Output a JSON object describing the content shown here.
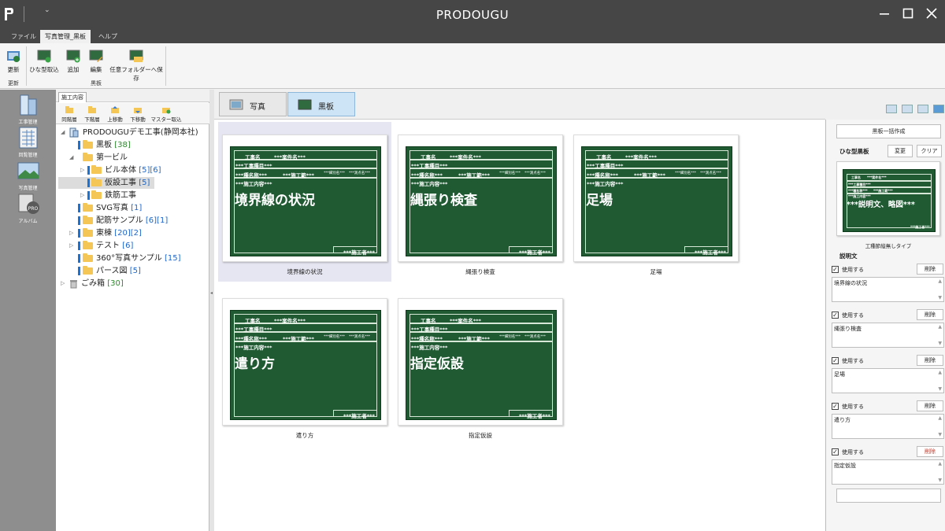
{
  "app": {
    "title": "PRODOUGU",
    "quick_access": "⌄"
  },
  "menu": {
    "tabs": [
      "ファイル",
      "写真管理_黒板",
      "ヘルプ"
    ],
    "active": 1
  },
  "ribbon": {
    "refresh_label": "更新",
    "refresh_group": "更新",
    "buttons": [
      "ひな型取込",
      "追加",
      "編集",
      "任意フォルダーへ保存"
    ],
    "board_group": "黒板"
  },
  "leftbar": [
    "工事管理",
    "回覧管理",
    "写真管理",
    "アルバム"
  ],
  "tree": {
    "tab": "施工内容",
    "tools": [
      "同階層",
      "下階層",
      "上移動",
      "下移動",
      "マスター取込"
    ],
    "nodes": [
      {
        "label": "PRODOUGUデモ工事(静岡本社)"
      },
      {
        "label": "黒板",
        "count": "[38]"
      },
      {
        "label": "第一ビル"
      },
      {
        "label": "ビル本体",
        "count": "[5][6]"
      },
      {
        "label": "仮設工事",
        "count": "[5]"
      },
      {
        "label": "鉄筋工事"
      },
      {
        "label": "SVG写真",
        "count": "[1]"
      },
      {
        "label": "配筋サンプル",
        "count": "[6][1]"
      },
      {
        "label": "東棟",
        "count": "[20][2]"
      },
      {
        "label": "テスト",
        "count": "[6]"
      },
      {
        "label": "360°写真サンプル",
        "count": "[15]"
      },
      {
        "label": "パース図",
        "count": "[5]"
      },
      {
        "label": "ごみ箱",
        "count": "[30]"
      }
    ]
  },
  "content_tabs": [
    "写真",
    "黒板"
  ],
  "board_template": {
    "kouji_mei": "工事名",
    "anken": "***案件名***",
    "kouji_shumoku": "***工事種目***",
    "shubetsu": "***種名称***",
    "kouji_ku": "***施工範***",
    "small1": "***細別名***",
    "small2": "***測点名***",
    "sekou_naiyou": "***施工内容***",
    "sekousha": "***施工者***"
  },
  "boards": [
    {
      "title": "境界線の状況",
      "caption": "境界線の状況"
    },
    {
      "title": "縄張り検査",
      "caption": "縄張り検査"
    },
    {
      "title": "足場",
      "caption": "足場"
    },
    {
      "title": "遣り方",
      "caption": "遣り方"
    },
    {
      "title": "指定仮設",
      "caption": "指定仮設"
    }
  ],
  "right_panel": {
    "bulk_button": "黒板一括作成",
    "template_label": "ひな型黒板",
    "change_button": "変更",
    "clear_button": "クリア",
    "preview_text": "***説明文、略図***",
    "template_name": "工種節縦無しタイプ",
    "description_label": "説明文",
    "use_label": "使用する",
    "delete_label": "削除",
    "items": [
      "境界線の状況",
      "縄張り検査",
      "足場",
      "遣り方",
      "指定仮設"
    ]
  }
}
